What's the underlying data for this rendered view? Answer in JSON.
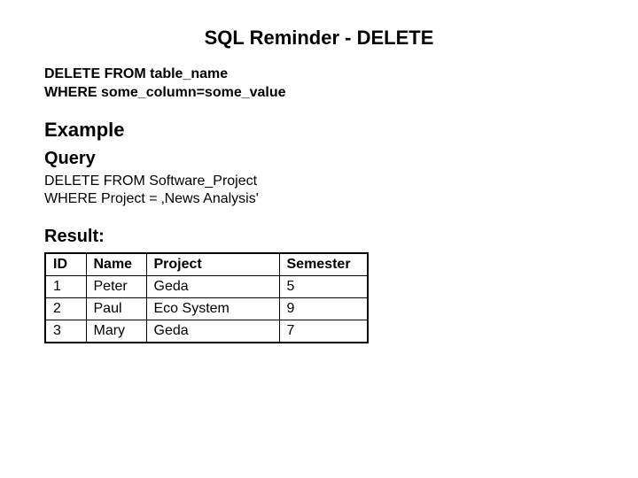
{
  "title": "SQL Reminder - DELETE",
  "syntax": {
    "line1": "DELETE FROM table_name",
    "line2": "WHERE some_column=some_value"
  },
  "example_heading": "Example",
  "query_heading": "Query",
  "query": {
    "line1": "DELETE FROM Software_Project",
    "line2": "WHERE Project = ‚News Analysis'"
  },
  "result_heading": "Result:",
  "table": {
    "headers": [
      "ID",
      "Name",
      "Project",
      "Semester"
    ],
    "rows": [
      [
        "1",
        "Peter",
        "Geda",
        "5"
      ],
      [
        "2",
        "Paul",
        "Eco System",
        "9"
      ],
      [
        "3",
        "Mary",
        "Geda",
        "7"
      ]
    ]
  }
}
